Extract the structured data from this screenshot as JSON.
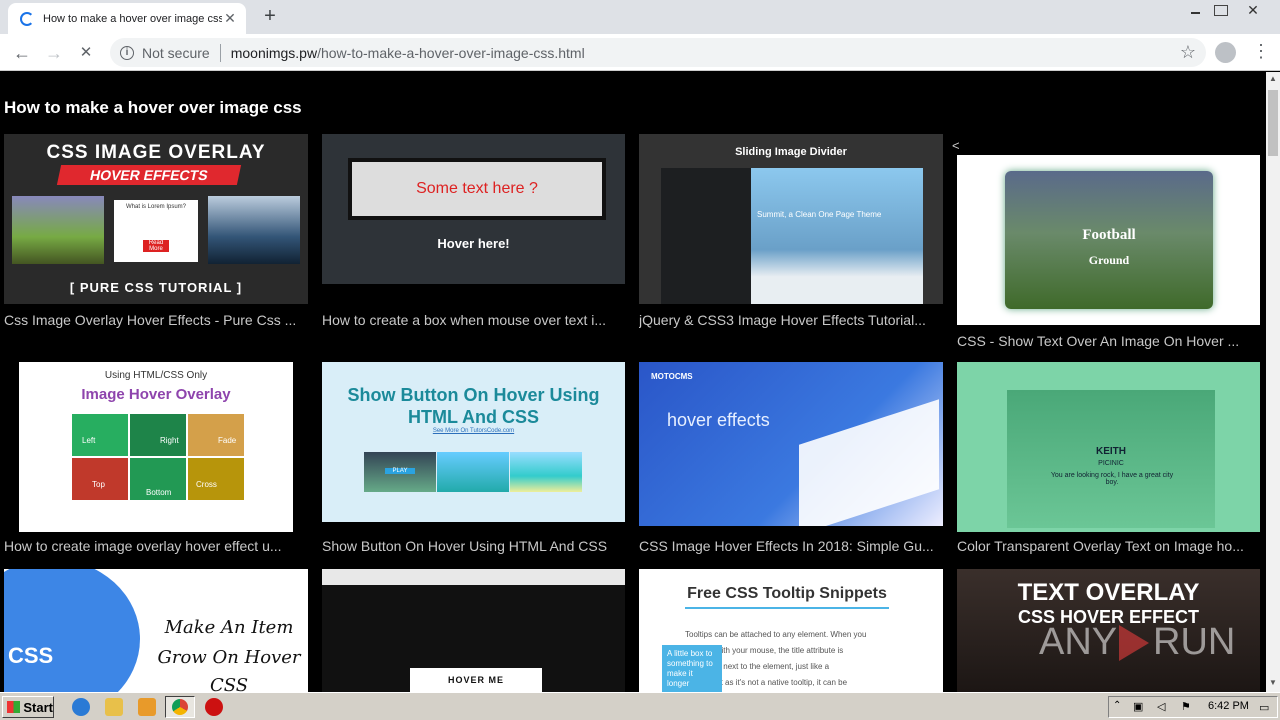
{
  "browser": {
    "tab_title": "How to make a hover over image css",
    "tab_close": "✕",
    "new_tab": "+",
    "security_label": "Not secure",
    "url_host": "moonimgs.pw",
    "url_path": "/how-to-make-a-hover-over-image-css.html",
    "back": "←",
    "forward": "→",
    "stop": "✕",
    "star": "☆",
    "menu": "⋮"
  },
  "page": {
    "title": "How to make a hover over image css",
    "stray_char": "<",
    "cards": [
      {
        "caption": "Css Image Overlay Hover Effects - Pure Css ...",
        "thumb_lines": [
          "CSS IMAGE OVERLAY",
          "HOVER EFFECTS",
          "[ PURE CSS TUTORIAL ]",
          "What is Lorem Ipsum?",
          "Read More"
        ]
      },
      {
        "caption": "How to create a box when mouse over text i...",
        "thumb_lines": [
          "Some text here ?",
          "Hover here!"
        ]
      },
      {
        "caption": "jQuery & CSS3 Image Hover Effects Tutorial...",
        "thumb_lines": [
          "Sliding Image Divider",
          "Summit, a Clean One Page Theme"
        ]
      },
      {
        "caption": "CSS - Show Text Over An Image On Hover ...",
        "thumb_lines": [
          "Football",
          "Ground"
        ]
      },
      {
        "caption": "How to create image overlay hover effect u...",
        "thumb_lines": [
          "Using HTML/CSS Only",
          "Image Hover Overlay",
          "Left",
          "Right",
          "Fade",
          "Top",
          "Cross",
          "Bottom"
        ]
      },
      {
        "caption": "Show Button On Hover Using HTML And CSS",
        "thumb_lines": [
          "Show Button On Hover Using",
          "HTML And CSS",
          "See More On TutorsCode.com",
          "PLAY"
        ]
      },
      {
        "caption": "CSS Image Hover Effects In 2018: Simple Gu...",
        "thumb_lines": [
          "MOTOCMS",
          "hover effects"
        ]
      },
      {
        "caption": "Color Transparent Overlay Text on Image ho...",
        "thumb_lines": [
          "KEITH",
          "PICINIC",
          "You are looking rock, I have a great city boy."
        ]
      },
      {
        "caption": "",
        "thumb_lines": [
          "CSS",
          "Make An Item",
          "Grow On Hover",
          "CSS"
        ]
      },
      {
        "caption": "",
        "thumb_lines": [
          "HOVER ME"
        ]
      },
      {
        "caption": "",
        "thumb_lines": [
          "Free CSS Tooltip Snippets",
          "A little box to something to make it longer",
          "Tooltips can be attached to any element. When you",
          "element with your mouse, the title attribute is",
          "a little box next to the element, just like a",
          "tooltip. But as it's not a native tooltip, it can be"
        ]
      },
      {
        "caption": "",
        "thumb_lines": [
          "TEXT OVERLAY",
          "CSS HOVER EFFECT",
          "ANY",
          "RUN"
        ]
      }
    ]
  },
  "taskbar": {
    "start_label": "Start",
    "clock": "6:42 PM"
  }
}
